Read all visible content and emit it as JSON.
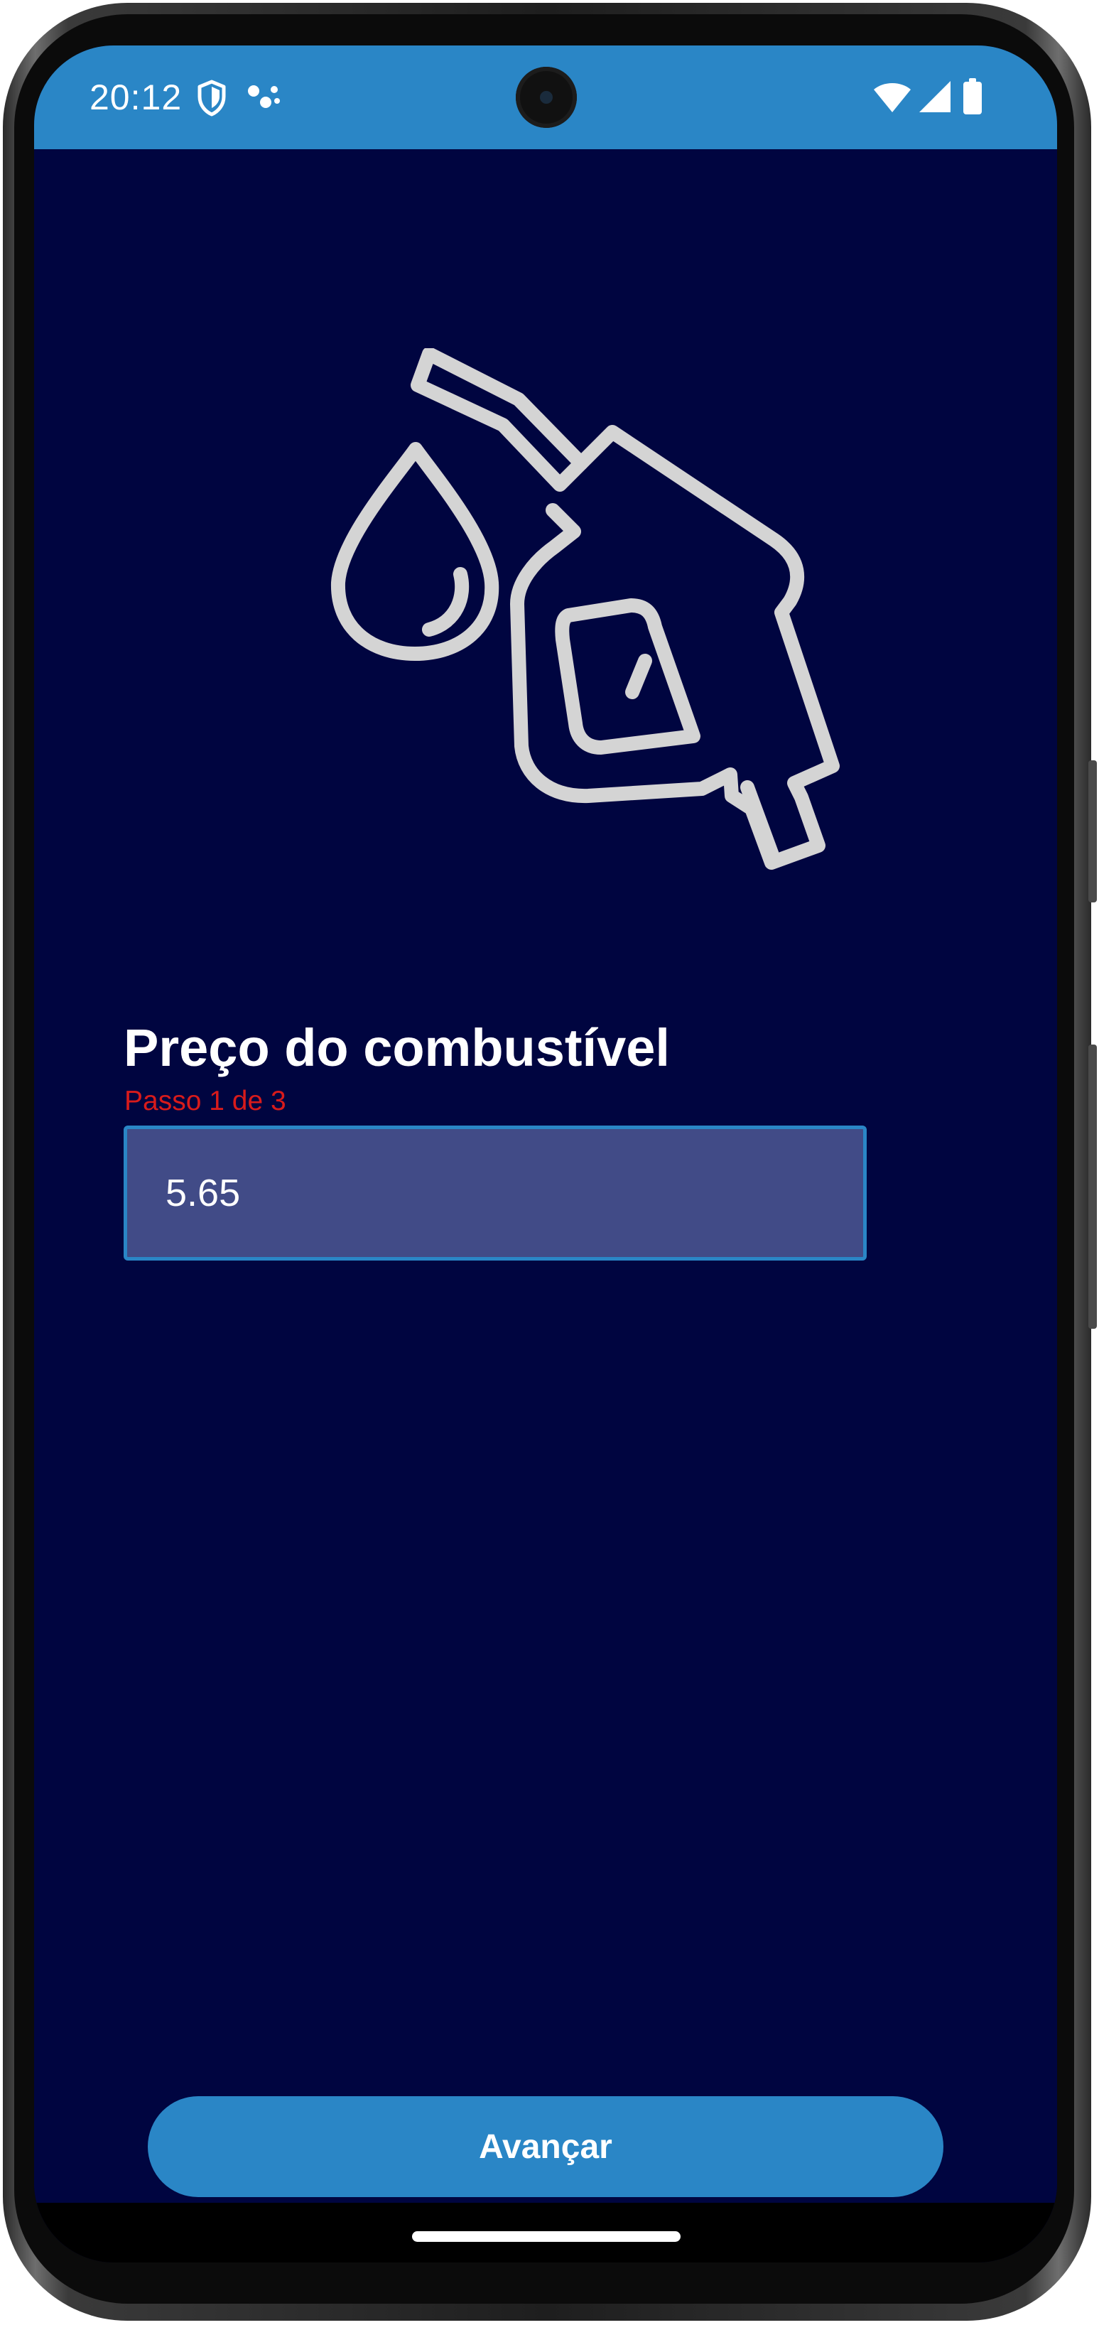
{
  "status_bar": {
    "time": "20:12",
    "icons": [
      "shield-icon",
      "dots-icon",
      "wifi-icon",
      "signal-icon",
      "battery-icon"
    ],
    "background_color": "#2a86c6"
  },
  "hero": {
    "icon": "fuel-pump-icon",
    "drop_icon": "fuel-drop-icon",
    "stroke_color": "#d4d4d4"
  },
  "form": {
    "title": "Preço do combustível",
    "step": "Passo 1 de 3",
    "price_value": "5.65"
  },
  "actions": {
    "next_label": "Avançar"
  },
  "colors": {
    "background": "#000540",
    "accent": "#2a86c6",
    "step_text": "#d81b1b",
    "input_fill": "#414b87"
  }
}
